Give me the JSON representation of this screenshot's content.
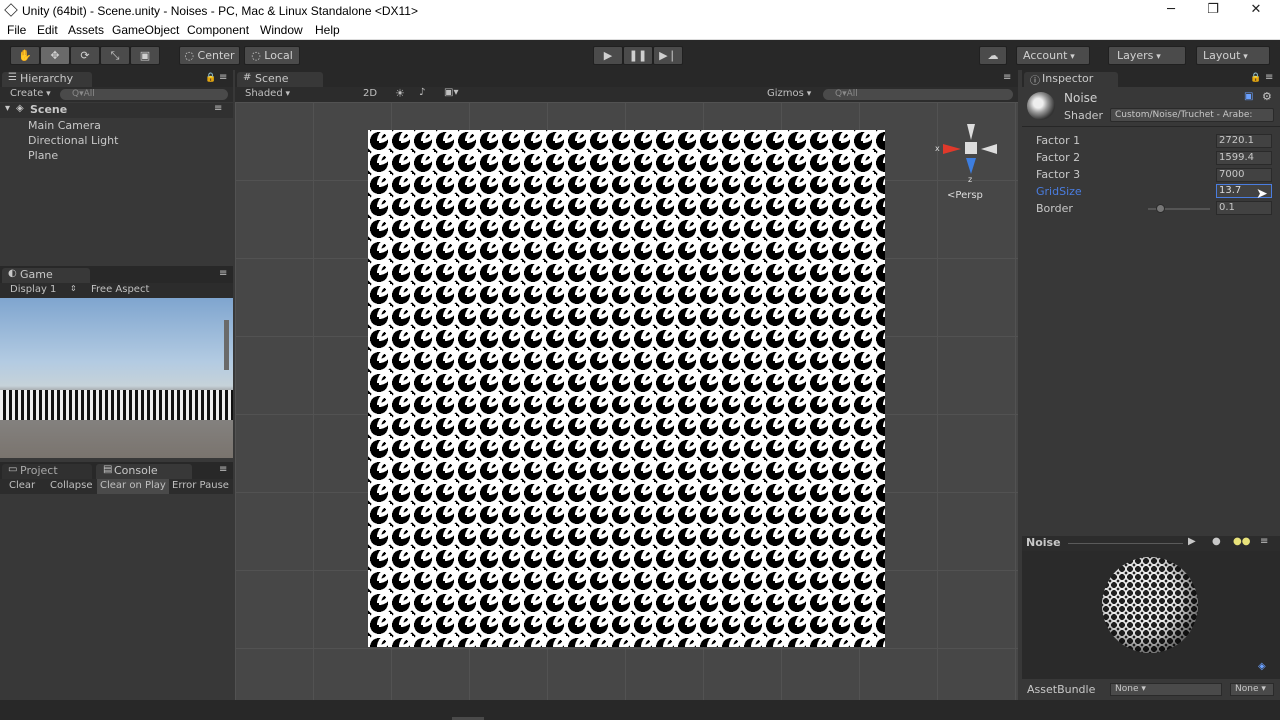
{
  "window": {
    "title": "Unity (64bit) - Scene.unity - Noises - PC, Mac & Linux Standalone <DX11>",
    "minimize": "─",
    "restore": "❐",
    "close": "✕"
  },
  "menu": [
    "File",
    "Edit",
    "Assets",
    "GameObject",
    "Component",
    "Window",
    "Help"
  ],
  "toolbar": {
    "pivot_center": "Center",
    "pivot_local": "Local",
    "account": "Account",
    "layers": "Layers",
    "layout": "Layout"
  },
  "hierarchy": {
    "tab": "Hierarchy",
    "create": "Create",
    "search_placeholder": "Q▾All",
    "scene": "Scene",
    "items": [
      "Main Camera",
      "Directional Light",
      "Plane"
    ]
  },
  "game": {
    "tab": "Game",
    "display": "Display 1",
    "aspect": "Free Aspect"
  },
  "bottom_panel": {
    "tab_project": "Project",
    "tab_console": "Console",
    "buttons": [
      "Clear",
      "Collapse",
      "Clear on Play",
      "Error Pause"
    ]
  },
  "scene": {
    "tab": "Scene",
    "shading": "Shaded",
    "mode_2d": "2D",
    "gizmos": "Gizmos",
    "search_placeholder": "Q▾All",
    "persp": "Persp",
    "axis_x": "x",
    "axis_z": "z"
  },
  "inspector": {
    "tab": "Inspector",
    "material_name": "Noise",
    "shader_label": "Shader",
    "shader_value": "Custom/Noise/Truchet - Arabe:",
    "properties": [
      {
        "label": "Factor 1",
        "value": "2720.1"
      },
      {
        "label": "Factor 2",
        "value": "1599.4"
      },
      {
        "label": "Factor 3",
        "value": "7000"
      },
      {
        "label": "GridSize",
        "value": "13.7"
      },
      {
        "label": "Border",
        "value": "0.1"
      }
    ],
    "preview_title": "Noise",
    "assetbundle_label": "AssetBundle",
    "assetbundle_value": "None",
    "assetbundle_variant": "None"
  },
  "colors": {
    "accent": "#4a7de0",
    "panel": "#383838",
    "toolbar": "#282828"
  }
}
